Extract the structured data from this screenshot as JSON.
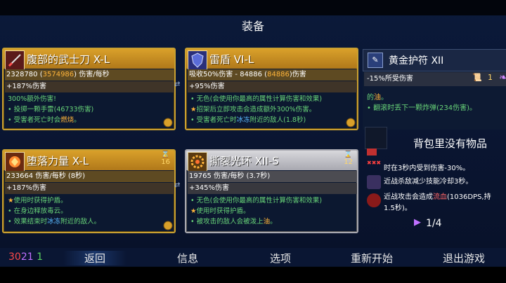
{
  "screen_title": "装备",
  "cards": {
    "katana": {
      "name": "腹部的武士刀 X-L",
      "stat1_a": "2328780 (",
      "stat1_hl": "3574986",
      "stat1_b": ") 伤害/每秒",
      "stat2": "+187%伤害",
      "desc1": "300%额外伤害!",
      "desc2": "投掷一颗手雷(46733伤害)",
      "desc3_a": "受害者死亡时会",
      "desc3_hl": "燃烧",
      "desc3_b": "。"
    },
    "shield": {
      "name": "雷盾 VI-L",
      "stat1_a": "吸收50%伤害 - 84886 (",
      "stat1_hl": "84886",
      "stat1_b": ")伤害",
      "stat2": "+95%伤害",
      "desc1": "无色(会使用你最高的属性计算伤害和效果)",
      "desc2": "招架后立即攻击会造成额外300%伤害。",
      "desc3_a": "受害者死亡时",
      "desc3_hl": "冰冻",
      "desc3_b": "附近的敌人(1.8秒)"
    },
    "fallen": {
      "name": "堕落力量 X-L",
      "hour": "16",
      "stat1": "233664 伤害/每秒 (8秒)",
      "stat2": "+187%伤害",
      "desc1": "使用时获得护盾。",
      "desc2": "在身边释放毒云。",
      "desc3_a": "效果结束时",
      "desc3_hl": "冰冻",
      "desc3_b": "附近的敌人。"
    },
    "aura": {
      "name": "撕裂光环 XII-S",
      "hour": "12",
      "stat1": "19765 伤害/每秒 (3.7秒)",
      "stat2": "+345%伤害",
      "desc1": "无色(会使用你最高的属性计算伤害和效果)",
      "desc2": "使用时获得护盾。",
      "desc3_a": "被攻击的敌人会被泼上",
      "desc3_hl": "油",
      "desc3_b": "。"
    }
  },
  "amulet": {
    "name": "黄金护符 XII",
    "stat": "-15%所受伤害",
    "scroll_count": "1",
    "desc1_a": "的",
    "desc1_hl": "油",
    "desc1_b": "。",
    "desc2": "翻滚时丢下一颗炸弹(234伤害)。"
  },
  "bag": {
    "empty_text": "背包里没有物品"
  },
  "effects": [
    {
      "text": "时在3秒内受到伤害-30%。"
    },
    {
      "text": "近战杀敌减少技能冷却3秒。"
    },
    {
      "text_a": "近战攻击会造成",
      "text_hl": "流血",
      "text_b": "(1036DPS,持",
      "text2": "1.5秒)。"
    }
  ],
  "page": "1/4",
  "coins": {
    "a": "30",
    "b": "21",
    "c": "1"
  },
  "nav": {
    "back": "返回",
    "info": "信息",
    "options": "选项",
    "restart": "重新开始",
    "quit": "退出游戏"
  },
  "colors": {
    "gold_frame": "#c9a031",
    "highlight": "#ffb43a",
    "effect_green": "#68d478",
    "freeze_blue": "#59b9ff"
  }
}
